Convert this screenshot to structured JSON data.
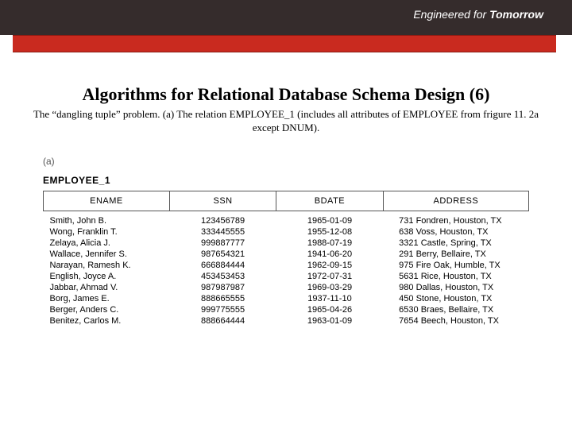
{
  "header": {
    "tagline_a": "Engineered for",
    "tagline_b": " Tomorrow"
  },
  "title": "Algorithms for Relational Database Schema Design (6)",
  "subtitle": "The “dangling tuple” problem. (a) The relation EMPLOYEE_1 (includes all attributes of EMPLOYEE from frigure 11. 2a except DNUM).",
  "figure": {
    "label": "(a)",
    "relation_name": "EMPLOYEE_1",
    "columns": [
      "ENAME",
      "SSN",
      "BDATE",
      "ADDRESS"
    ],
    "rows": [
      {
        "ename": "Smith, John B.",
        "ssn": "123456789",
        "bdate": "1965-01-09",
        "address": "731 Fondren, Houston, TX"
      },
      {
        "ename": "Wong, Franklin T.",
        "ssn": "333445555",
        "bdate": "1955-12-08",
        "address": "638 Voss, Houston, TX"
      },
      {
        "ename": "Zelaya, Alicia J.",
        "ssn": "999887777",
        "bdate": "1988-07-19",
        "address": "3321 Castle, Spring, TX"
      },
      {
        "ename": "Wallace, Jennifer S.",
        "ssn": "987654321",
        "bdate": "1941-06-20",
        "address": "291 Berry, Bellaire, TX"
      },
      {
        "ename": "Narayan, Ramesh K.",
        "ssn": "666884444",
        "bdate": "1962-09-15",
        "address": "975 Fire Oak, Humble, TX"
      },
      {
        "ename": "English, Joyce A.",
        "ssn": "453453453",
        "bdate": "1972-07-31",
        "address": "5631 Rice, Houston, TX"
      },
      {
        "ename": "Jabbar, Ahmad V.",
        "ssn": "987987987",
        "bdate": "1969-03-29",
        "address": "980 Dallas, Houston, TX"
      },
      {
        "ename": "Borg, James E.",
        "ssn": "888665555",
        "bdate": "1937-11-10",
        "address": "450 Stone, Houston, TX"
      },
      {
        "ename": "Berger, Anders C.",
        "ssn": "999775555",
        "bdate": "1965-04-26",
        "address": "6530 Braes, Bellaire, TX"
      },
      {
        "ename": "Benitez, Carlos M.",
        "ssn": "888664444",
        "bdate": "1963-01-09",
        "address": "7654 Beech, Houston, TX"
      }
    ]
  }
}
